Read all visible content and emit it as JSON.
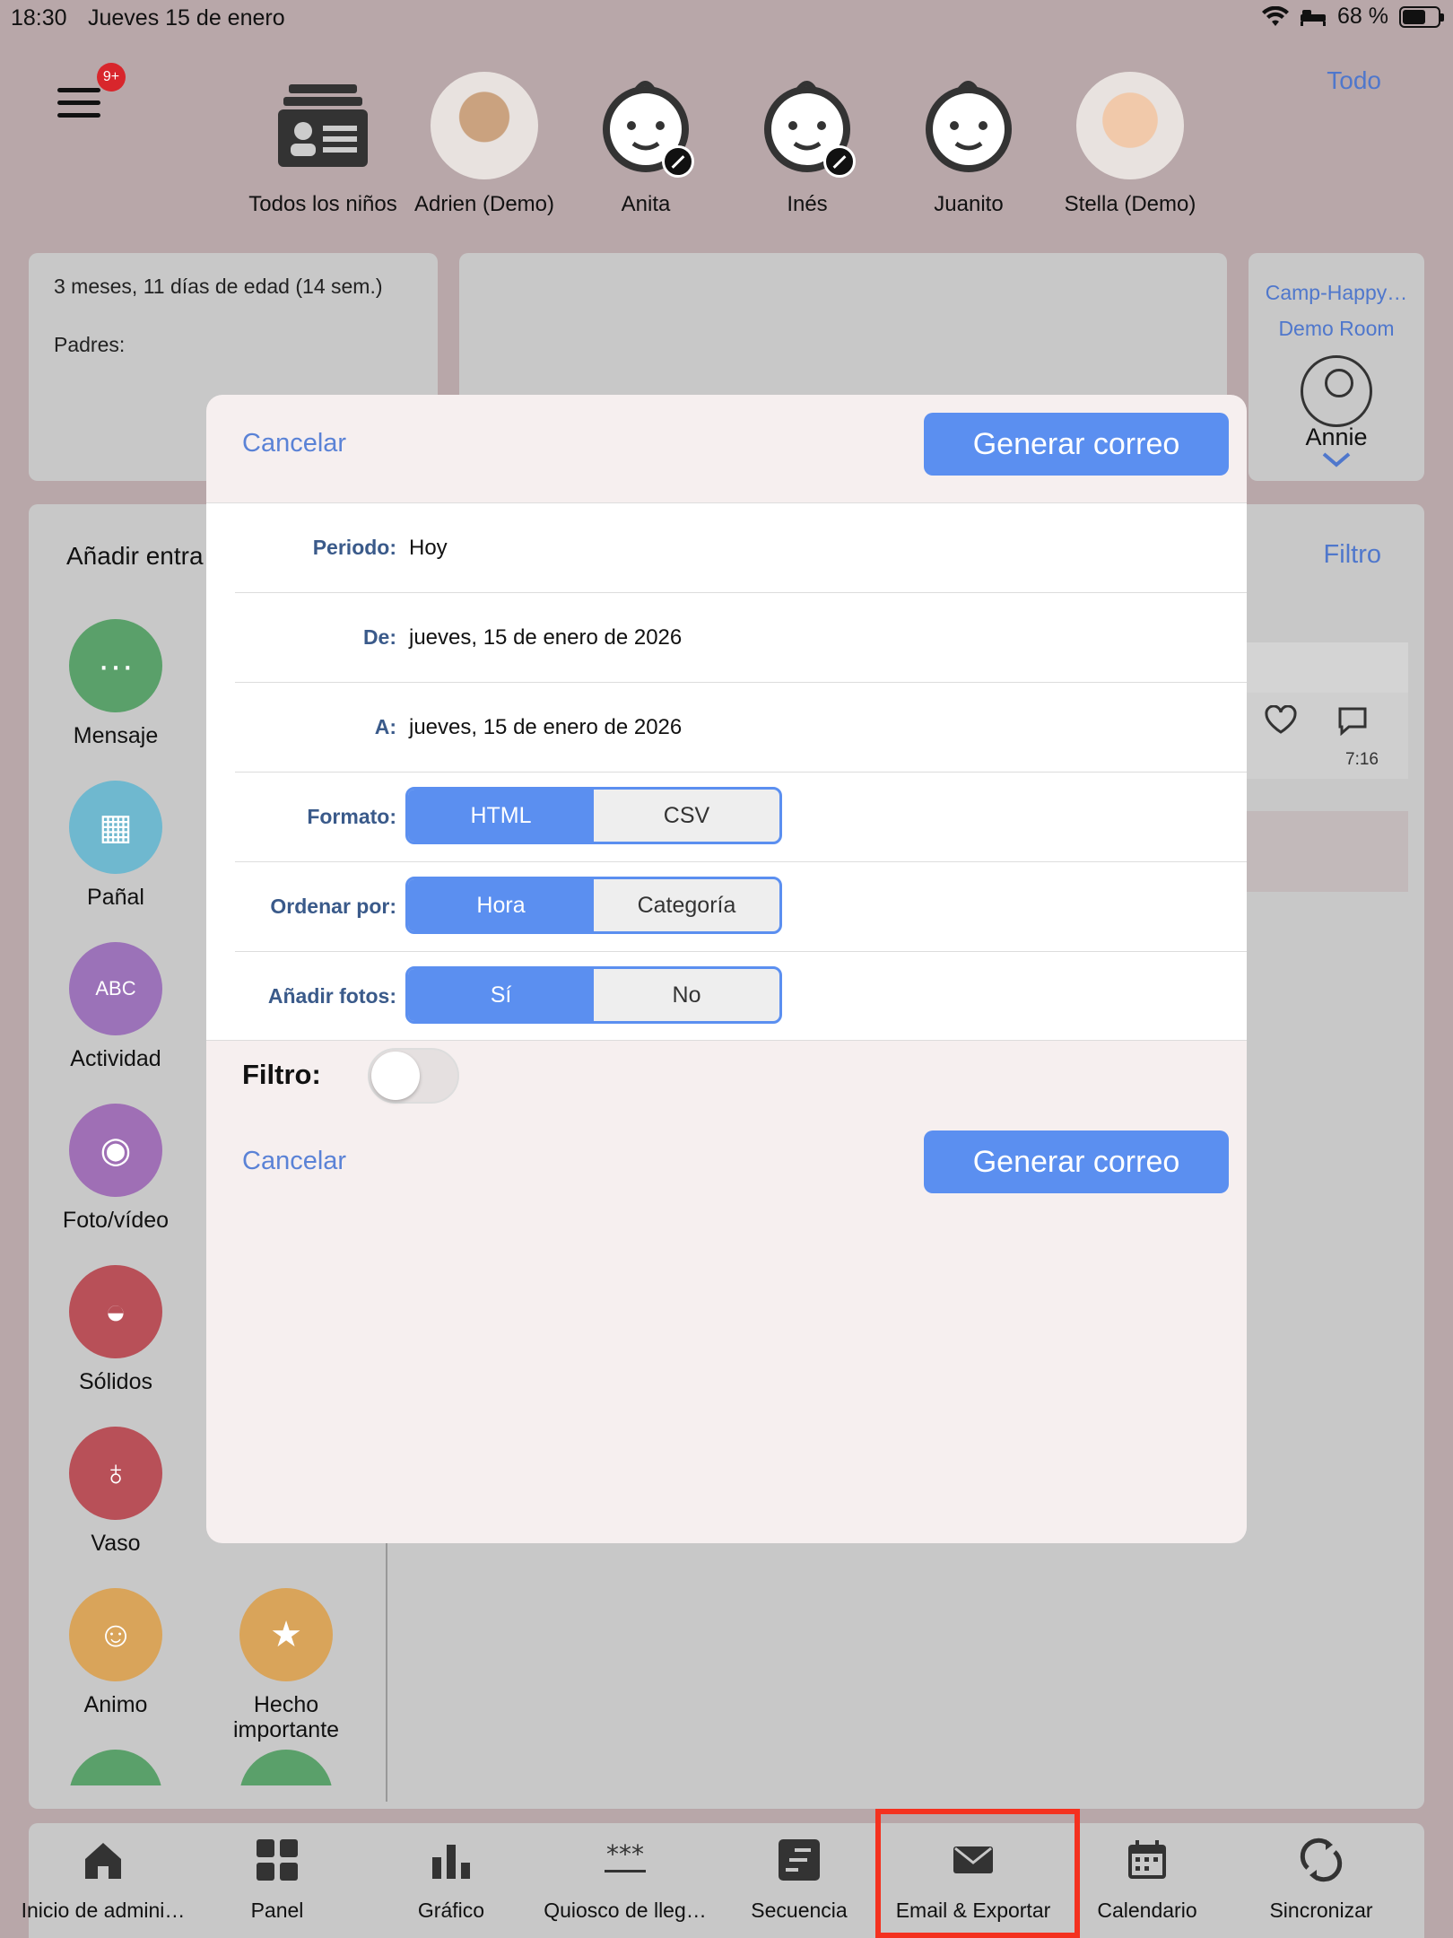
{
  "status": {
    "time": "18:30",
    "date": "Jueves 15 de enero",
    "battery": "68 %"
  },
  "header": {
    "badge": "9+",
    "todo": "Todo",
    "children": [
      {
        "name": "Todos los niños",
        "icon": "group-folder-icon"
      },
      {
        "name": "Adrien (Demo)",
        "icon": "photo"
      },
      {
        "name": "Anita",
        "icon": "baby-face-icon"
      },
      {
        "name": "Inés",
        "icon": "baby-face-icon"
      },
      {
        "name": "Juanito",
        "icon": "baby-face-icon"
      },
      {
        "name": "Stella (Demo)",
        "icon": "photo"
      }
    ]
  },
  "info": {
    "age": "3 meses, 11 días de edad (14 sem.)",
    "parents": "Padres:"
  },
  "room": {
    "line1": "Camp-Happy…",
    "line2": "Demo Room",
    "person": "Annie"
  },
  "main": {
    "add_entry": "Añadir entra",
    "filter": "Filtro",
    "feed_time": "7:16"
  },
  "activities": [
    {
      "label": "Mensaje",
      "color": "#5aa06a",
      "glyph": "···"
    },
    {
      "label": "Pañal",
      "color": "#6fb8cf",
      "glyph": "▦"
    },
    {
      "label": "Actividad",
      "color": "#9b72b8",
      "glyph": "ABC"
    },
    {
      "label": "Foto/vídeo",
      "color": "#9f6fb5",
      "glyph": "◉"
    },
    {
      "label": "Sólidos",
      "color": "#b85058",
      "glyph": "◒"
    },
    {
      "label": "Vaso",
      "color": "#b85058",
      "glyph": "♁"
    },
    {
      "label": "Animo",
      "color": "#d9a45a",
      "glyph": "☺"
    },
    {
      "label": "Hecho importante",
      "color": "#d9a45a",
      "glyph": "★"
    }
  ],
  "modal": {
    "cancel": "Cancelar",
    "generate": "Generar correo",
    "period_label": "Periodo:",
    "period_value": "Hoy",
    "from_label": "De:",
    "from_value": "jueves, 15 de enero de 2026",
    "to_label": "A:",
    "to_value": "jueves, 15 de enero de 2026",
    "format_label": "Formato:",
    "format_opts": [
      "HTML",
      "CSV"
    ],
    "sort_label": "Ordenar por:",
    "sort_opts": [
      "Hora",
      "Categoría"
    ],
    "photos_label": "Añadir fotos:",
    "photos_opts": [
      "Sí",
      "No"
    ],
    "filter_label": "Filtro:"
  },
  "tabs": [
    "Inicio de admini…",
    "Panel",
    "Gráfico",
    "Quiosco de lleg…",
    "Secuencia",
    "Email & Exportar",
    "Calendario",
    "Sincronizar"
  ],
  "colors": {
    "accent": "#5b8ff0",
    "link": "#4f77cc",
    "highlight": "#f4311f"
  }
}
